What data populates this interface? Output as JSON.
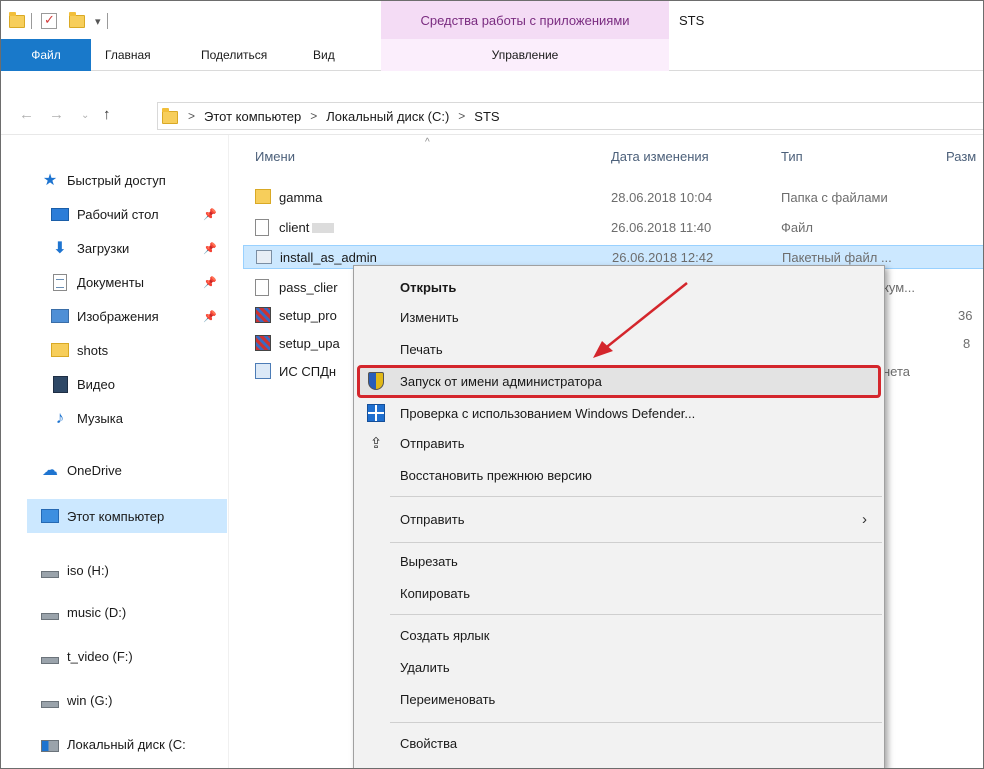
{
  "window": {
    "title": "STS",
    "context_tab_group": "Средства работы с приложениями"
  },
  "ribbon": {
    "tabs": [
      "Файл",
      "Главная",
      "Поделиться",
      "Вид",
      "Управление"
    ]
  },
  "address_bar": {
    "crumbs": [
      "Этот компьютер",
      "Локальный диск (C:)",
      "STS"
    ],
    "separator": ">"
  },
  "navigation": {
    "items": [
      {
        "label": "Быстрый доступ",
        "icon": "star-icon"
      },
      {
        "label": "Рабочий стол",
        "icon": "desktop-icon"
      },
      {
        "label": "Загрузки",
        "icon": "download-icon"
      },
      {
        "label": "Документы",
        "icon": "document-icon"
      },
      {
        "label": "Изображения",
        "icon": "pictures-icon"
      },
      {
        "label": "shots",
        "icon": "folder-icon"
      },
      {
        "label": "Видео",
        "icon": "video-icon"
      },
      {
        "label": "Музыка",
        "icon": "music-icon"
      },
      {
        "label": "OneDrive",
        "icon": "cloud-icon"
      },
      {
        "label": "Этот компьютер",
        "icon": "computer-icon"
      },
      {
        "label": "iso (H:)",
        "icon": "drive-icon"
      },
      {
        "label": "music (D:)",
        "icon": "drive-icon"
      },
      {
        "label": "t_video (F:)",
        "icon": "drive-icon"
      },
      {
        "label": "win (G:)",
        "icon": "drive-icon"
      },
      {
        "label": "Локальный диск (C:",
        "icon": "system-drive-icon"
      }
    ]
  },
  "columns": {
    "name": "Имени",
    "date": "Дата изменения",
    "type": "Тип",
    "size": "Разм"
  },
  "files": [
    {
      "name": "gamma",
      "date": "28.06.2018 10:04",
      "type": "Папка с файлами",
      "size": ""
    },
    {
      "name": "client",
      "date": "26.06.2018 11:40",
      "type": "Файл",
      "size": ""
    },
    {
      "name": "install_as_admin",
      "date": "26.06.2018 12:42",
      "type": "Пакетный файл ...",
      "size": ""
    },
    {
      "name": "pass_clier",
      "date": "",
      "type": "кум...",
      "size": ""
    },
    {
      "name": "setup_pro",
      "date": "",
      "type": "",
      "size": "36"
    },
    {
      "name": "setup_upa",
      "date": "",
      "type": "",
      "size": "8"
    },
    {
      "name": "ИС СПДн",
      "date": "",
      "type": "нета",
      "size": ""
    }
  ],
  "context_menu": {
    "items": [
      {
        "label": "Открыть",
        "bold": true
      },
      {
        "label": "Изменить"
      },
      {
        "label": "Печать"
      },
      {
        "label": "Запуск от имени администратора",
        "icon": "uac-shield-icon"
      },
      {
        "label": "Проверка с использованием Windows Defender...",
        "icon": "defender-icon"
      },
      {
        "label": "Отправить",
        "icon": "share-icon"
      },
      {
        "label": "Восстановить прежнюю версию"
      },
      {
        "label": "Отправить",
        "submenu": true
      },
      {
        "label": "Вырезать"
      },
      {
        "label": "Копировать"
      },
      {
        "label": "Создать ярлык"
      },
      {
        "label": "Удалить"
      },
      {
        "label": "Переименовать"
      },
      {
        "label": "Свойства"
      }
    ]
  },
  "annotation": {
    "highlight_color": "#d4262c",
    "arrow_color": "#d4262c"
  },
  "colors": {
    "file_tab": "#1979ca",
    "context_tab": "#f4dcf5",
    "selection": "#cce8ff"
  }
}
